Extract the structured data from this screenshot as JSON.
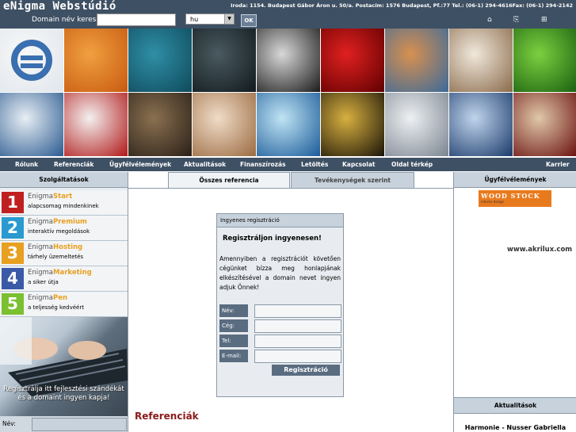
{
  "header": {
    "logo": "eNigma Webstúdió",
    "address": "Iroda: 1154. Budapest Gábor Áron u. 50/a. Postacím: 1576 Budapest, Pf.:77 Tel.: (06-1) 294-4616Fax: (06-1) 294-2142",
    "domain_label": "Domain név kereső:",
    "domain_value": "",
    "tld_selected": "hu",
    "ok_label": "OK",
    "icons": [
      "home-icon",
      "sitemap-icon",
      "network-icon"
    ]
  },
  "tiles": [
    {
      "name": "enigma-logo-tile",
      "colors": [
        "#f8f8f8",
        "#e0e6ec"
      ]
    },
    {
      "name": "orange-stripes-tile",
      "colors": [
        "#f0a040",
        "#c85a10"
      ]
    },
    {
      "name": "teal-net-tile",
      "colors": [
        "#2f8fa6",
        "#0f4a5c"
      ]
    },
    {
      "name": "dark-stones-tile",
      "colors": [
        "#4a5a60",
        "#111a1e"
      ]
    },
    {
      "name": "black-white-pattern-tile",
      "colors": [
        "#d8d8d8",
        "#1a1a1a"
      ]
    },
    {
      "name": "red-candle-tile",
      "colors": [
        "#e02020",
        "#600000"
      ]
    },
    {
      "name": "glass-spiral-tile",
      "colors": [
        "#d89050",
        "#3a6a9a"
      ]
    },
    {
      "name": "shell-lines-tile",
      "colors": [
        "#f0e8dc",
        "#8a6a4a"
      ]
    },
    {
      "name": "green-water-drops-tile",
      "colors": [
        "#7cd040",
        "#1a6010"
      ]
    },
    {
      "name": "blue-wave-tile",
      "colors": [
        "#e8eef4",
        "#2a5a90"
      ]
    },
    {
      "name": "red-flower-tile",
      "colors": [
        "#f4f0f0",
        "#b01818"
      ]
    },
    {
      "name": "owl-eye-tile",
      "colors": [
        "#8a7050",
        "#2a2018"
      ]
    },
    {
      "name": "seashell-tile",
      "colors": [
        "#f0dcc8",
        "#9a6a40"
      ]
    },
    {
      "name": "blue-ice-tile",
      "colors": [
        "#c0e4f4",
        "#1a5a98"
      ]
    },
    {
      "name": "gold-ornament-tile",
      "colors": [
        "#d8b040",
        "#1a1408"
      ]
    },
    {
      "name": "white-structure-tile",
      "colors": [
        "#eef0f2",
        "#7a8490"
      ]
    },
    {
      "name": "swans-tile",
      "colors": [
        "#c0d4ec",
        "#1a3a6a"
      ]
    },
    {
      "name": "red-window-tile",
      "colors": [
        "#e0c8a8",
        "#6a1010"
      ]
    }
  ],
  "nav": {
    "items": [
      "Rólunk",
      "Referenciák",
      "Ügyfélvélemények",
      "Aktualitások",
      "Finanszírozás",
      "Letöltés",
      "Kapcsolat",
      "Oldal térkép"
    ],
    "right": "Karrier"
  },
  "left": {
    "title": "Szolgáltatások",
    "services": [
      {
        "num": "1",
        "prefix": "Enigma",
        "name": "Start",
        "desc": "alapcsomag mindenkinek",
        "color": "#c02020",
        "accent": "#e8a020"
      },
      {
        "num": "2",
        "prefix": "Enigma",
        "name": "Premium",
        "desc": "interaktív megoldások",
        "color": "#2a9ad0",
        "accent": "#e8a020"
      },
      {
        "num": "3",
        "prefix": "Enigma",
        "name": "Hosting",
        "desc": "tárhely üzemeltetés",
        "color": "#e8a020",
        "accent": "#e8a020"
      },
      {
        "num": "4",
        "prefix": "Enigma",
        "name": "Marketing",
        "desc": "a siker útja",
        "color": "#3a5aa8",
        "accent": "#e8a020"
      },
      {
        "num": "5",
        "prefix": "Enigma",
        "name": "Pen",
        "desc": "a teljesség kedvéért",
        "color": "#7ac030",
        "accent": "#e8a020"
      }
    ],
    "promo": "Regisztrálja itt fejlesztési szándékát és a domaint ingyen kapja!",
    "nev_label": "Név:"
  },
  "tabs": {
    "active": "Összes referencia",
    "other": "Tevékenységek szerint"
  },
  "registration": {
    "header": "Ingyenes regisztráció",
    "title": "Regisztráljon ingyenesen!",
    "text": "Amennyiben a regisztrációt követően cégünket bízza meg honlapjának elkészítésével a domain nevet ingyen adjuk Önnek!",
    "fields": [
      "Név:",
      "Cég:",
      "Tel:",
      "E-mail:"
    ],
    "button": "Regisztráció"
  },
  "center": {
    "section_title": "Referenciák"
  },
  "right": {
    "title": "Ügyfélvélemények",
    "client_logo": "WOOD STOCK",
    "client_logo_sub": "interior design",
    "url": "www.akrilux.com",
    "news_title": "Aktualitások",
    "news_item": "Harmonie - Nusser Gabriella"
  }
}
